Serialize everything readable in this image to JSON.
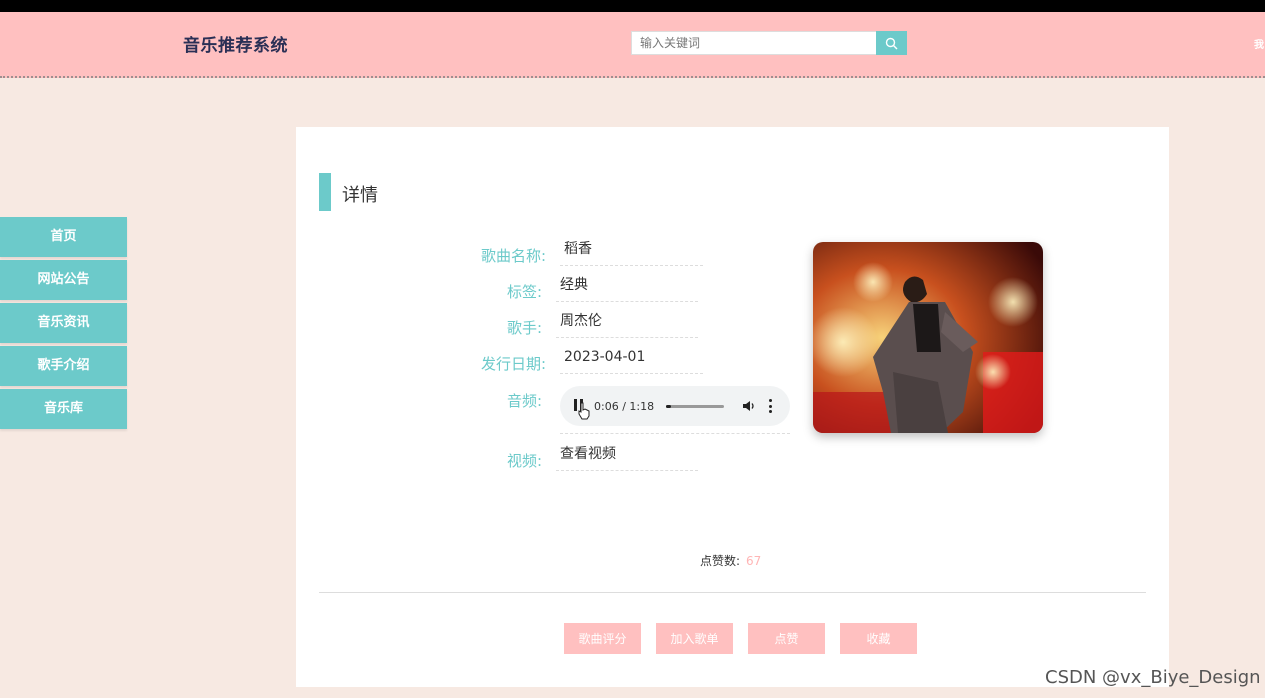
{
  "header": {
    "site_title": "音乐推荐系统",
    "search_placeholder": "输入关键词",
    "right_text": "我"
  },
  "sidebar": {
    "items": [
      {
        "label": "首页"
      },
      {
        "label": "网站公告"
      },
      {
        "label": "音乐资讯"
      },
      {
        "label": "歌手介绍"
      },
      {
        "label": "音乐库"
      }
    ]
  },
  "detail": {
    "section_title": "详情",
    "fields": {
      "song_name_label": "歌曲名称:",
      "song_name": "稻香",
      "tag_label": "标签:",
      "tag": "经典",
      "singer_label": "歌手:",
      "singer": "周杰伦",
      "release_label": "发行日期:",
      "release_date": "2023-04-01",
      "audio_label": "音频:",
      "video_label": "视频:",
      "video_link": "查看视频"
    },
    "audio": {
      "time": "0:06 / 1:18",
      "progress": 0.08
    },
    "likes_label": "点赞数:",
    "likes_count": "67"
  },
  "actions": {
    "rate": "歌曲评分",
    "add_playlist": "加入歌单",
    "like": "点赞",
    "favorite": "收藏"
  },
  "watermark": "CSDN @vx_Biye_Design",
  "colors": {
    "header_bg": "#ffc0c0",
    "accent": "#6ccaca",
    "page_bg": "#f7e9e2",
    "button_bg": "#ffc0c0"
  }
}
